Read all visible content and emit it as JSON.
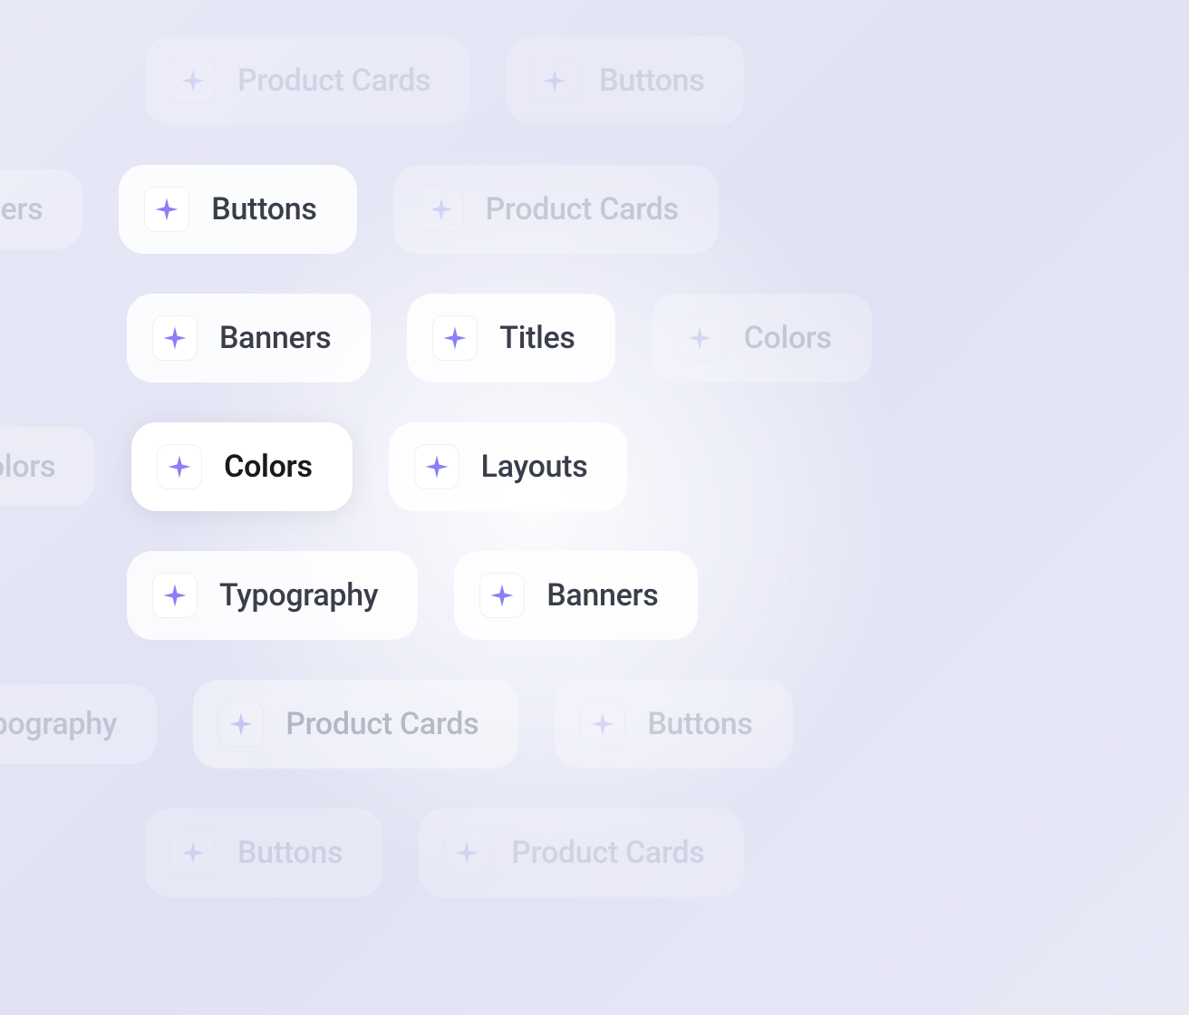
{
  "chips": {
    "product_cards": "Product Cards",
    "buttons": "Buttons",
    "banners": "Banners",
    "titles": "Titles",
    "colors": "Colors",
    "layouts": "Layouts",
    "typography": "Typography"
  },
  "rows": [
    [
      {
        "label_key": "product_cards",
        "variant": "very-dim",
        "has_icon": true
      },
      {
        "label_key": "buttons",
        "variant": "very-dim",
        "has_icon": true
      }
    ],
    [
      {
        "label_key": "banners",
        "variant": "edge",
        "has_icon": false
      },
      {
        "label_key": "buttons",
        "variant": "",
        "has_icon": true
      },
      {
        "label_key": "product_cards",
        "variant": "edge",
        "has_icon": true
      }
    ],
    [
      {
        "label_key": "banners",
        "variant": "",
        "has_icon": true
      },
      {
        "label_key": "titles",
        "variant": "",
        "has_icon": true
      },
      {
        "label_key": "colors",
        "variant": "edge",
        "has_icon": true
      }
    ],
    [
      {
        "label_key": "colors",
        "variant": "edge",
        "has_icon": false
      },
      {
        "label_key": "colors",
        "variant": "focused",
        "has_icon": true
      },
      {
        "label_key": "layouts",
        "variant": "",
        "has_icon": true
      }
    ],
    [
      {
        "label_key": "typography",
        "variant": "",
        "has_icon": true
      },
      {
        "label_key": "banners",
        "variant": "",
        "has_icon": true
      }
    ],
    [
      {
        "label_key": "typography",
        "variant": "edge",
        "has_icon": false
      },
      {
        "label_key": "product_cards",
        "variant": "dim",
        "has_icon": true
      },
      {
        "label_key": "buttons",
        "variant": "edge",
        "has_icon": true
      }
    ],
    [
      {
        "label_key": "buttons",
        "variant": "very-dim",
        "has_icon": true
      },
      {
        "label_key": "product_cards",
        "variant": "very-dim",
        "has_icon": true
      }
    ]
  ]
}
